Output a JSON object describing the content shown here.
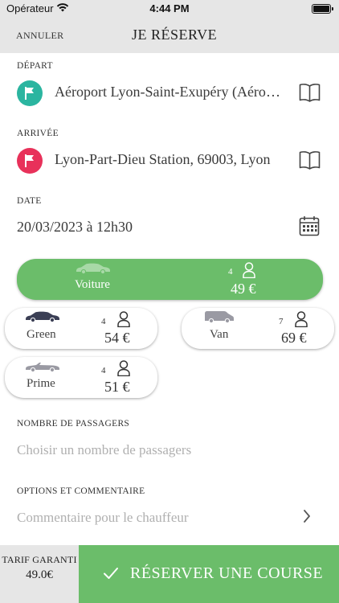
{
  "status_bar": {
    "carrier": "Opérateur",
    "time": "4:44 PM"
  },
  "nav": {
    "cancel": "ANNULER",
    "title": "JE RÉSERVE"
  },
  "departure": {
    "label": "DÉPART",
    "value": "Aéroport Lyon-Saint-Exupéry (Aéroport)",
    "color": "#2bb5a0"
  },
  "arrival": {
    "label": "ARRIVÉE",
    "value": "Lyon-Part-Dieu Station, 69003, Lyon",
    "color": "#e8315a"
  },
  "date": {
    "label": "DATE",
    "value": "20/03/2023 à 12h30"
  },
  "vehicles": [
    {
      "name": "Voiture",
      "seats": "4",
      "price": "49 €",
      "selected": true
    },
    {
      "name": "Green",
      "seats": "4",
      "price": "54 €",
      "selected": false
    },
    {
      "name": "Van",
      "seats": "7",
      "price": "69 €",
      "selected": false
    },
    {
      "name": "Prime",
      "seats": "4",
      "price": "51 €",
      "selected": false
    }
  ],
  "passengers": {
    "label": "NOMBRE DE PASSAGERS",
    "placeholder": "Choisir un nombre de passagers"
  },
  "options": {
    "label": "OPTIONS ET COMMENTAIRE",
    "placeholder": "Commentaire pour le chauffeur"
  },
  "footer": {
    "tarif_label": "TARIF GARANTI",
    "tarif_value": "49.0€",
    "reserve_label": "RÉSERVER UNE COURSE"
  },
  "colors": {
    "accent_green": "#6bbd6a",
    "bar_gray": "#e6e6e6"
  }
}
